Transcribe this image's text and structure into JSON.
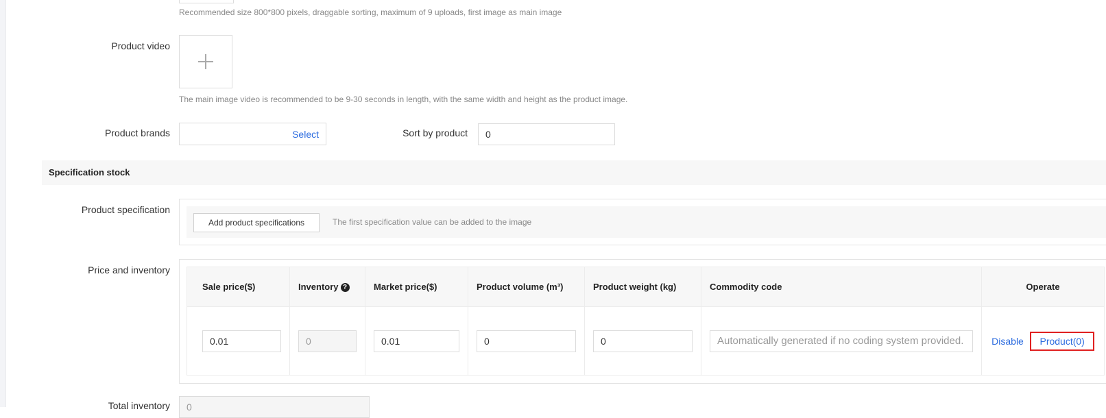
{
  "main_image": {
    "hint": "Recommended size 800*800 pixels, draggable sorting, maximum of 9 uploads, first image as main image"
  },
  "product_video": {
    "label": "Product video",
    "hint": "The main image video is recommended to be 9-30 seconds in length, with the same width and height as the product image."
  },
  "brands": {
    "label": "Product brands",
    "select_label": "Select"
  },
  "sort": {
    "label": "Sort by product",
    "value": "0"
  },
  "spec_stock": {
    "title": "Specification stock",
    "spec_label": "Product specification",
    "add_button": "Add product specifications",
    "add_hint": "The first specification value can be added to the image"
  },
  "price_inventory": {
    "label": "Price and inventory",
    "columns": [
      {
        "label": "Sale price($)"
      },
      {
        "label": "Inventory"
      },
      {
        "label": "Market price($)"
      },
      {
        "label": "Product volume (m³)"
      },
      {
        "label": "Product weight (kg)"
      },
      {
        "label": "Commodity code"
      },
      {
        "label": "Operate"
      }
    ],
    "row": {
      "sale_price": "0.01",
      "inventory": "0",
      "market_price": "0.01",
      "volume": "0",
      "weight": "0",
      "code_placeholder": "Automatically generated if no coding system provided.",
      "disable_label": "Disable",
      "product_label": "Product(0)"
    }
  },
  "total_inventory": {
    "label": "Total inventory",
    "value": "0"
  },
  "colors": {
    "link": "#2d6cdf",
    "highlight_border": "#e02020"
  }
}
